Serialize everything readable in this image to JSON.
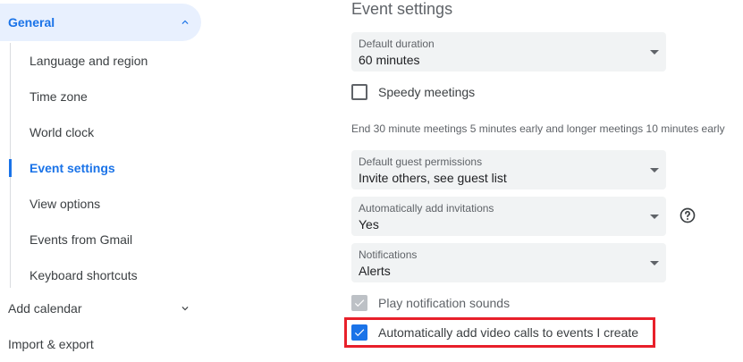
{
  "sidebar": {
    "general_label": "General",
    "sub_items": [
      {
        "label": "Language and region"
      },
      {
        "label": "Time zone"
      },
      {
        "label": "World clock"
      },
      {
        "label": "Event settings"
      },
      {
        "label": "View options"
      },
      {
        "label": "Events from Gmail"
      },
      {
        "label": "Keyboard shortcuts"
      }
    ],
    "active_item": "Event settings",
    "add_calendar_label": "Add calendar",
    "import_export_label": "Import & export"
  },
  "main": {
    "section_title": "Event settings",
    "default_duration": {
      "caption": "Default duration",
      "value": "60 minutes"
    },
    "speedy_meetings": {
      "label": "Speedy meetings",
      "checked": false
    },
    "speedy_hint": "End 30 minute meetings 5 minutes early and longer meetings 10 minutes early",
    "guest_permissions": {
      "caption": "Default guest permissions",
      "value": "Invite others, see guest list"
    },
    "auto_invitations": {
      "caption": "Automatically add invitations",
      "value": "Yes"
    },
    "notifications": {
      "caption": "Notifications",
      "value": "Alerts"
    },
    "play_sounds": {
      "label": "Play notification sounds",
      "checked": true,
      "disabled": true
    },
    "auto_video_calls": {
      "label": "Automatically add video calls to events I create",
      "checked": true
    }
  },
  "colors": {
    "accent": "#1a73e8",
    "accent_bg": "#e8f0fe",
    "field_bg": "#f1f3f4",
    "highlight": "#e8202a"
  },
  "icons": {
    "general_chevron": "chevron-up-icon",
    "add_calendar_chevron": "chevron-down-icon",
    "help": "help-icon",
    "select_caret": "caret-down-icon"
  }
}
